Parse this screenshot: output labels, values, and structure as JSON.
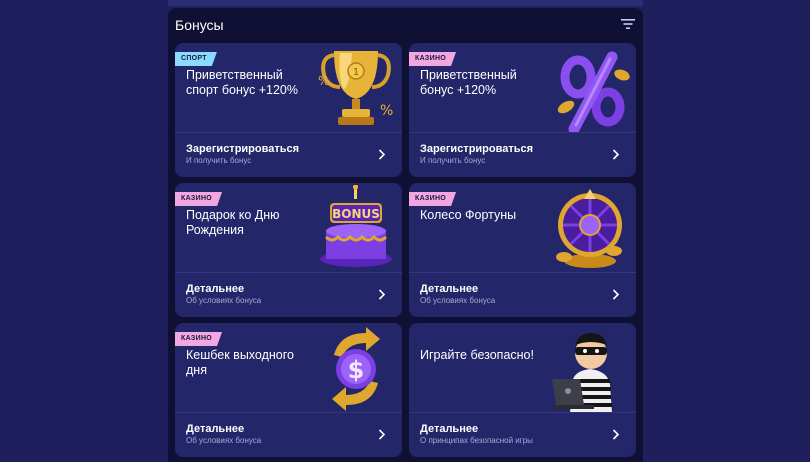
{
  "header": {
    "title": "Бонусы",
    "filter_icon": "filter-icon"
  },
  "cards": [
    {
      "tag": "СПОРТ",
      "title": "Приветственный спорт бонус +120%",
      "action": "Зарегистрироваться",
      "subtitle": "И получить бонус",
      "image": "trophy-icon"
    },
    {
      "tag": "КАЗИНО",
      "title": "Приветственный бонус +120%",
      "action": "Зарегистрироваться",
      "subtitle": "И получить бонус",
      "image": "percent-icon"
    },
    {
      "tag": "КАЗИНО",
      "title": "Подарок ко Дню Рождения",
      "action": "Детальнее",
      "subtitle": "Об условиях бонуса",
      "image": "bonus-cake-icon",
      "art_text": "BONUS"
    },
    {
      "tag": "КАЗИНО",
      "title": "Колесо Фортуны",
      "action": "Детальнее",
      "subtitle": "Об условиях бонуса",
      "image": "fortune-wheel-icon"
    },
    {
      "tag": "КАЗИНО",
      "title": "Кешбек выходного дня",
      "action": "Детальнее",
      "subtitle": "Об условиях бонуса",
      "image": "cashback-dollar-icon"
    },
    {
      "tag": "",
      "title": "Играйте безопасно!",
      "action": "Детальнее",
      "subtitle": "О принципах безопасной игры",
      "image": "hacker-icon"
    }
  ],
  "colors": {
    "background": "#1e1f5c",
    "panel": "#0f1033",
    "card": "#24266a",
    "sport_tag": "#8ad9ff",
    "casino_tag": "#f2a7e3",
    "gold": "#e0a72e",
    "purple": "#7b3fe4"
  }
}
